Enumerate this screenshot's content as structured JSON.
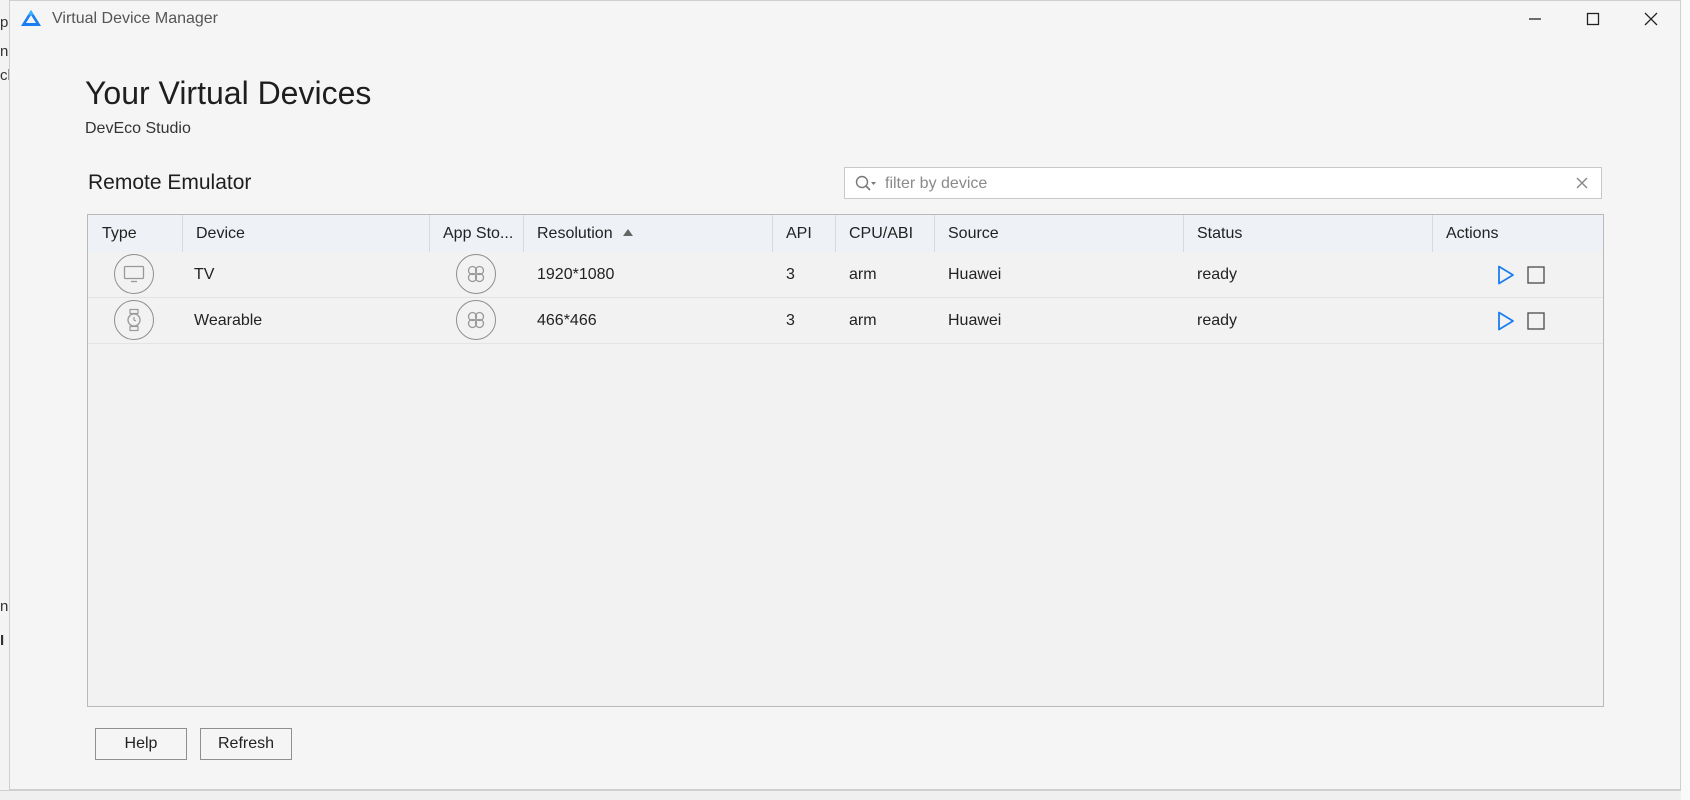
{
  "window": {
    "title": "Virtual Device Manager",
    "accent_color": "#1a7ef0"
  },
  "page": {
    "heading": "Your Virtual Devices",
    "subheading": "DevEco Studio",
    "section_title": "Remote Emulator"
  },
  "search": {
    "placeholder": "filter by device",
    "value": "",
    "icon": "search-icon",
    "clear_icon": "close-icon"
  },
  "table": {
    "columns": [
      "Type",
      "Device",
      "App Sto...",
      "Resolution",
      "API",
      "CPU/ABI",
      "Source",
      "Status",
      "Actions"
    ],
    "sorted_column": "Resolution",
    "sort_direction": "ascending",
    "rows": [
      {
        "type_icon": "tv-icon",
        "device": "TV",
        "app_store_icon": "app-store-icon",
        "resolution": "1920*1080",
        "api": "3",
        "cpu_abi": "arm",
        "source": "Huawei",
        "status": "ready",
        "actions": [
          "play-icon",
          "stop-icon"
        ]
      },
      {
        "type_icon": "watch-icon",
        "device": "Wearable",
        "app_store_icon": "app-store-icon",
        "resolution": "466*466",
        "api": "3",
        "cpu_abi": "arm",
        "source": "Huawei",
        "status": "ready",
        "actions": [
          "play-icon",
          "stop-icon"
        ]
      }
    ]
  },
  "footer": {
    "help_label": "Help",
    "refresh_label": "Refresh"
  },
  "background_app": {
    "left_fragments": [
      "p",
      "na",
      "ch",
      "n",
      "I"
    ]
  }
}
